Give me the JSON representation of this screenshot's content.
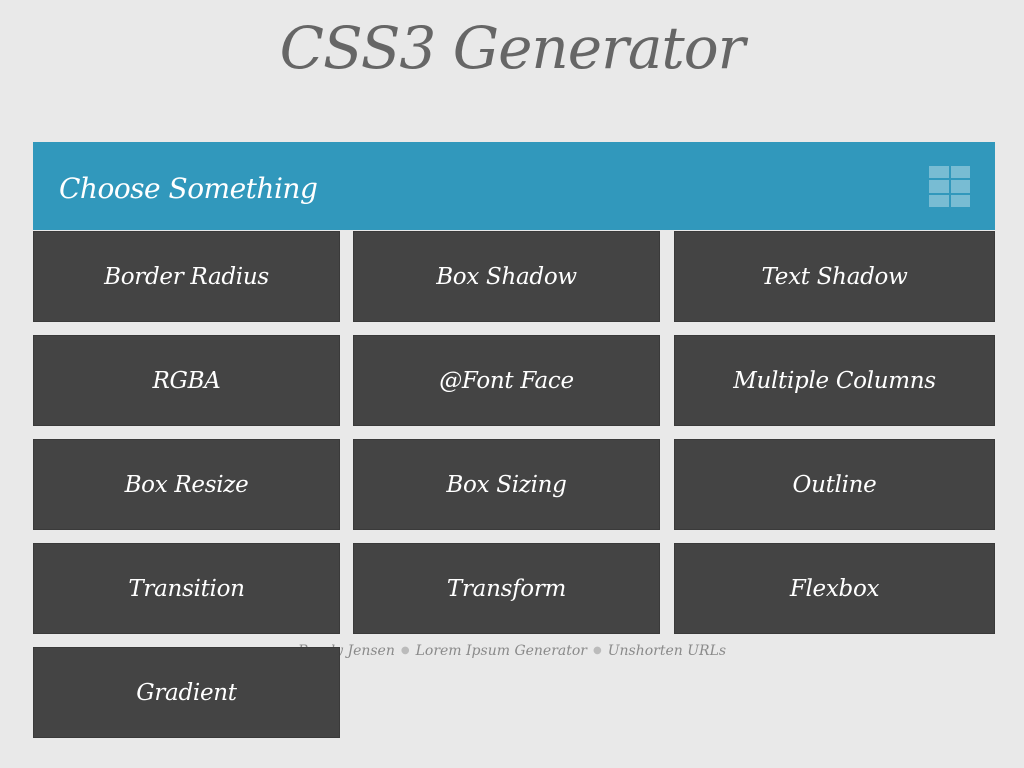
{
  "page": {
    "title": "CSS3 Generator"
  },
  "header": {
    "title": "Choose Something",
    "menu_icon": "grid-icon"
  },
  "tiles": [
    {
      "label": "Border Radius"
    },
    {
      "label": "Box Shadow"
    },
    {
      "label": "Text Shadow"
    },
    {
      "label": "RGBA"
    },
    {
      "label": "@Font Face"
    },
    {
      "label": "Multiple Columns"
    },
    {
      "label": "Box Resize"
    },
    {
      "label": "Box Sizing"
    },
    {
      "label": "Outline"
    },
    {
      "label": "Transition"
    },
    {
      "label": "Transform"
    },
    {
      "label": "Flexbox"
    },
    {
      "label": "Gradient"
    }
  ],
  "footer": {
    "links": [
      {
        "label": "Randy Jensen"
      },
      {
        "label": "Lorem Ipsum Generator"
      },
      {
        "label": "Unshorten URLs"
      }
    ],
    "separator": "●"
  },
  "colors": {
    "background": "#e9e9e9",
    "header": "#3198bc",
    "tile": "#444444",
    "title_text": "#666666"
  }
}
